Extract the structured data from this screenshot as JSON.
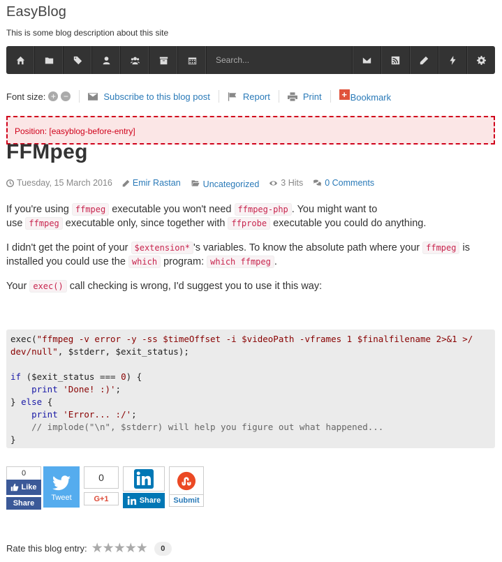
{
  "site": {
    "title": "EasyBlog",
    "description": "This is some blog description about this site"
  },
  "toolbar": {
    "search_placeholder": "Search...",
    "left_icons": [
      "home-icon",
      "folder-icon",
      "tags-icon",
      "user-icon",
      "users-icon",
      "archive-icon",
      "calendar-icon"
    ],
    "right_icons": [
      "envelope-icon",
      "rss-icon",
      "pencil-icon",
      "bolt-icon",
      "gear-icon"
    ]
  },
  "tools": {
    "font_size_label": "Font size:",
    "font_plus": "+",
    "font_minus": "−",
    "subscribe": "Subscribe to this blog post",
    "report": "Report",
    "print": "Print",
    "bookmark": "Bookmark"
  },
  "position_notice": "Position: [easyblog-before-entry]",
  "post": {
    "title": "FFMpeg",
    "date": "Tuesday, 15 March 2016",
    "author": "Emir Rastan",
    "category": "Uncategorized",
    "hits": "3 Hits",
    "comments": "0 Comments",
    "p1": {
      "t1": "If you're using ",
      "c1": "ffmpeg",
      "t2": " executable you won't need ",
      "c2": "ffmpeg-php",
      "t3": ". You might want to",
      "t4": "use ",
      "c3": "ffmpeg",
      "t5": " executable only, since together with ",
      "c4": "ffprobe",
      "t6": " executable you could do anything."
    },
    "p2": {
      "t1": "I didn't get the point of your ",
      "c1": "$extension*",
      "t2": "'s variables. To know the absolute path where your ",
      "c2": "ffmpeg",
      "t3": " is",
      "t4": "installed you could use the ",
      "c3": "which",
      "t5": " program: ",
      "c4": "which ffmpeg",
      "t6": "."
    },
    "p3": {
      "t1": "Your ",
      "c1": "exec()",
      "t2": " call checking is wrong, I'd suggest you to use it this way:"
    }
  },
  "share": {
    "fb_count": "0",
    "fb_like": "Like",
    "fb_share": "Share",
    "tweet": "Tweet",
    "gplus_count": "0",
    "gplus_label": "G+1",
    "linkedin": "Share",
    "stumble": "Submit"
  },
  "rating": {
    "label": "Rate this blog entry:",
    "count": "0",
    "stars": "★★★★★"
  }
}
